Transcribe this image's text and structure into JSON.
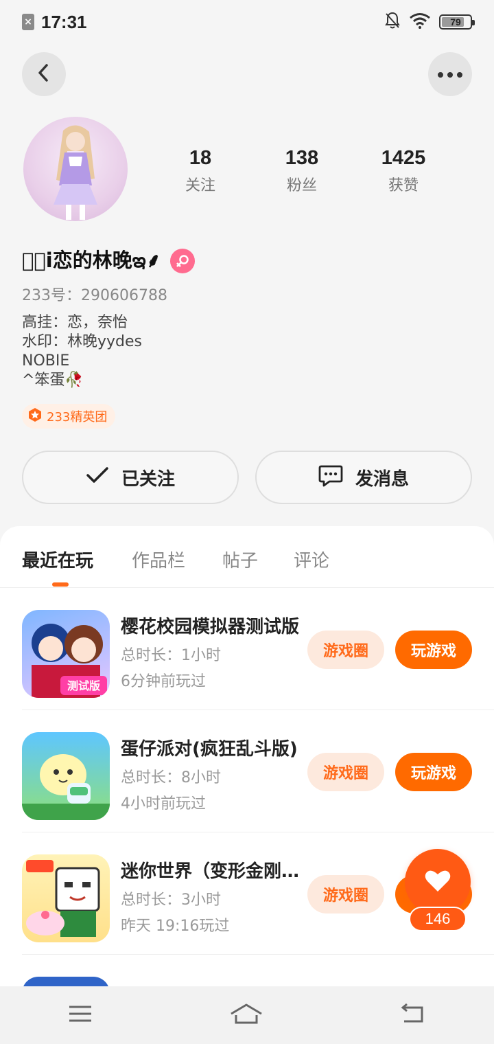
{
  "status_bar": {
    "time": "17:31",
    "battery_level": "79",
    "battery_fraction": 0.79
  },
  "profile": {
    "stats": [
      {
        "value": "18",
        "label": "关注"
      },
      {
        "value": "138",
        "label": "粉丝"
      },
      {
        "value": "1425",
        "label": "获赞"
      }
    ],
    "nickname": "ꦿ゙i恋的林晚ఇ⸙",
    "gender": "female",
    "uid": "233号：290606788",
    "bio": [
      "高挂：恋，奈怡",
      "水印：林晚yydes",
      "NOBIE",
      "^笨蛋🥀"
    ],
    "badge": "233精英团"
  },
  "actions": {
    "follow_label": "已关注",
    "message_label": "发消息"
  },
  "tabs": [
    "最近在玩",
    "作品栏",
    "帖子",
    "评论"
  ],
  "games": [
    {
      "title": "樱花校园模拟器测试版",
      "duration": "总时长：1小时",
      "last_played": "6分钟前玩过",
      "icon": "sakura-school-icon"
    },
    {
      "title": "蛋仔派对(疯狂乱斗版)",
      "duration": "总时长：8小时",
      "last_played": "4小时前玩过",
      "icon": "eggy-party-icon"
    },
    {
      "title": "迷你世界（变形金刚联动）",
      "duration": "总时长：3小时",
      "last_played": "昨天 19:16玩过",
      "icon": "mini-world-icon"
    }
  ],
  "game_buttons": {
    "circle_label": "游戏圈",
    "play_label": "玩游戏"
  },
  "like": {
    "count": "146"
  },
  "colors": {
    "accent": "#ff6a00",
    "accent_light": "#fde9dd",
    "gender_pink": "#ff6b8f"
  }
}
